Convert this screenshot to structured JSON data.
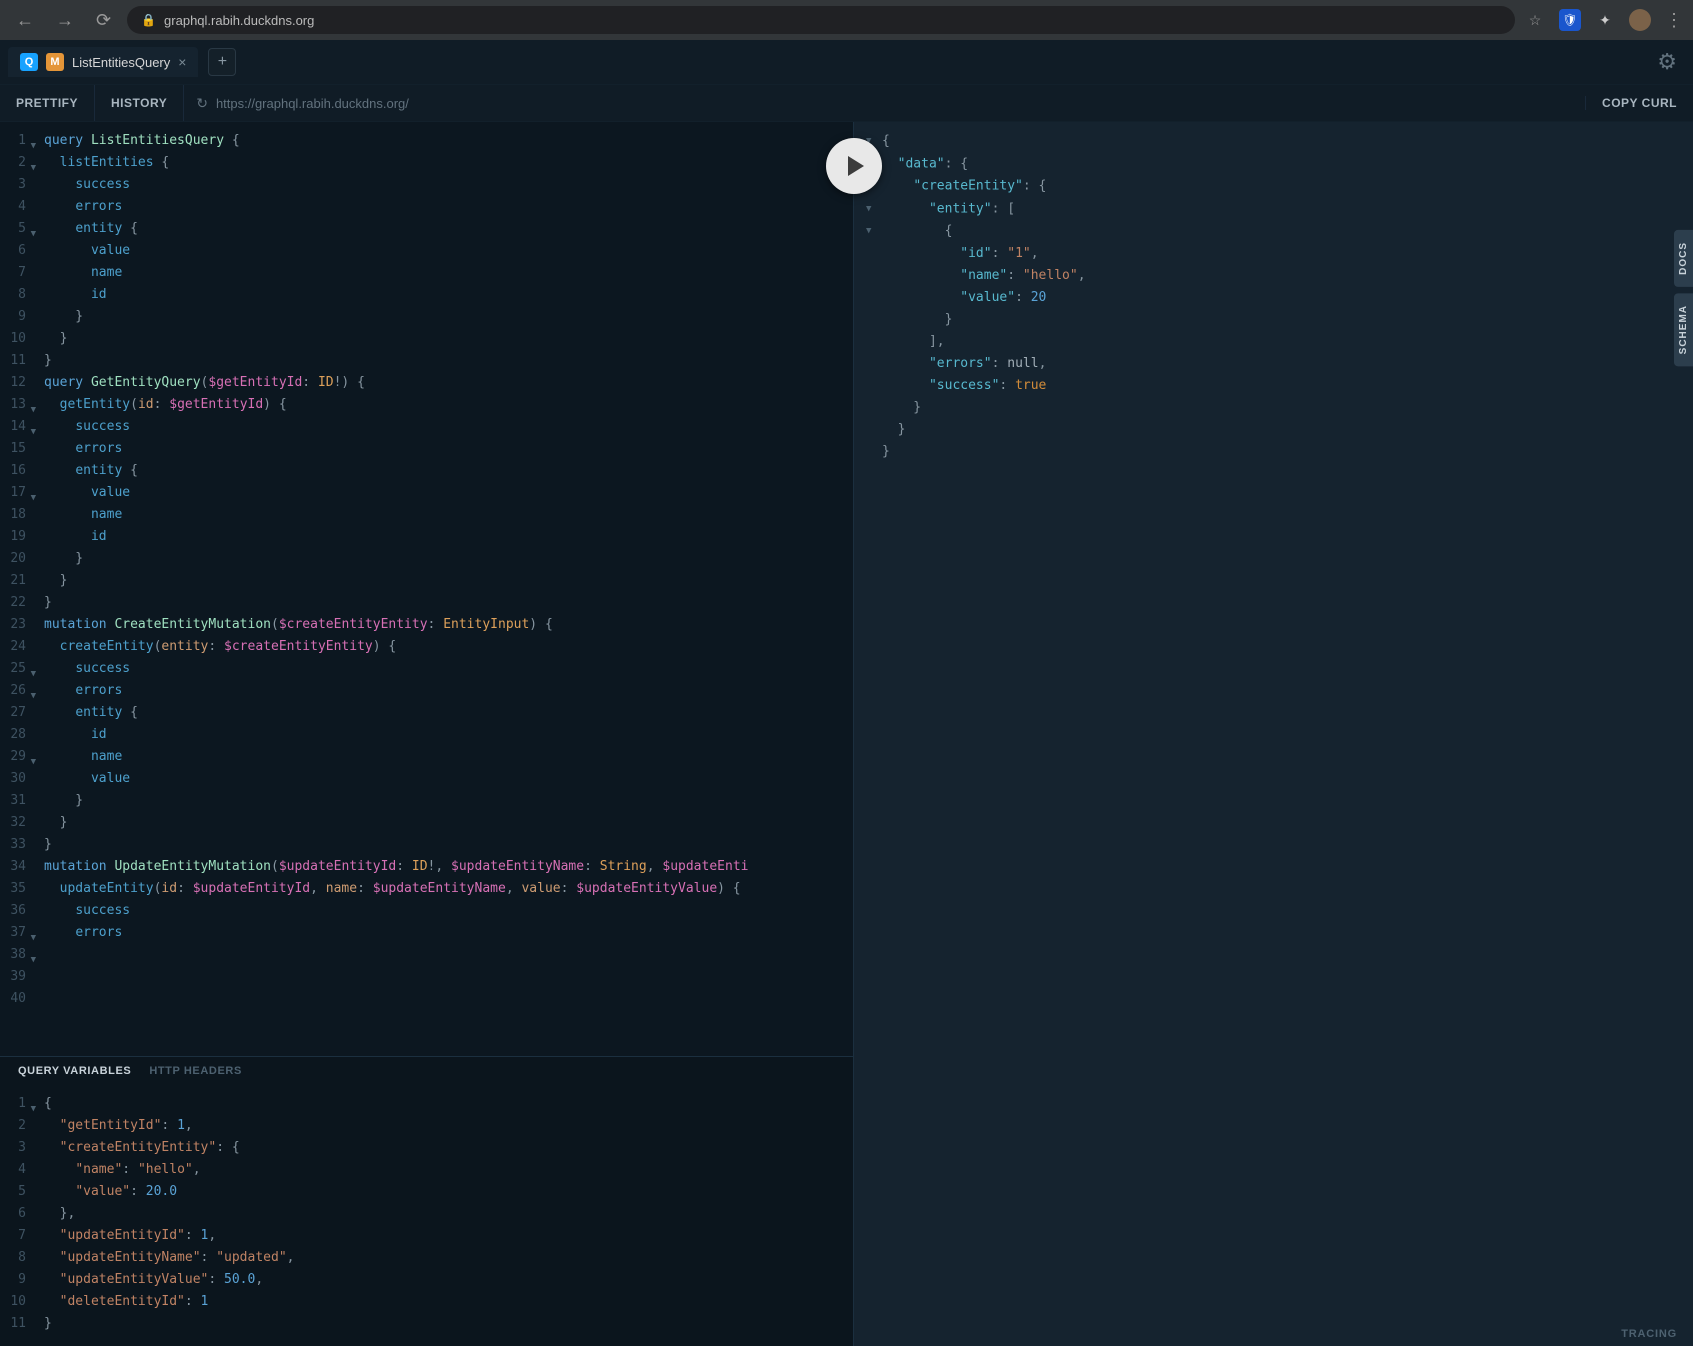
{
  "browser": {
    "url_host": "graphql.rabih.duckdns.org"
  },
  "tab": {
    "title": "ListEntitiesQuery"
  },
  "toolbar": {
    "prettify": "PRETTIFY",
    "history": "HISTORY",
    "url": "https://graphql.rabih.duckdns.org/",
    "copy_curl": "COPY CURL"
  },
  "side_tabs": {
    "docs": "DOCS",
    "schema": "SCHEMA"
  },
  "vars_tabs": {
    "query_vars": "QUERY VARIABLES",
    "http_headers": "HTTP HEADERS"
  },
  "tracing": "TRACING",
  "query_lines": [
    {
      "n": 1,
      "fold": true,
      "t": [
        [
          "k-def",
          "query "
        ],
        [
          "k-name",
          "ListEntitiesQuery"
        ],
        [
          "k-punct",
          " {"
        ]
      ]
    },
    {
      "n": 2,
      "fold": true,
      "t": [
        [
          "k-punct",
          "  "
        ],
        [
          "k-field",
          "listEntities"
        ],
        [
          "k-punct",
          " {"
        ]
      ]
    },
    {
      "n": 3,
      "t": [
        [
          "k-punct",
          "    "
        ],
        [
          "k-field",
          "success"
        ]
      ]
    },
    {
      "n": 4,
      "t": [
        [
          "k-punct",
          "    "
        ],
        [
          "k-field",
          "errors"
        ]
      ]
    },
    {
      "n": 5,
      "fold": true,
      "t": [
        [
          "k-punct",
          "    "
        ],
        [
          "k-field",
          "entity"
        ],
        [
          "k-punct",
          " {"
        ]
      ]
    },
    {
      "n": 6,
      "t": [
        [
          "k-punct",
          "      "
        ],
        [
          "k-field",
          "value"
        ]
      ]
    },
    {
      "n": 7,
      "t": [
        [
          "k-punct",
          "      "
        ],
        [
          "k-field",
          "name"
        ]
      ]
    },
    {
      "n": 8,
      "t": [
        [
          "k-punct",
          "      "
        ],
        [
          "k-field",
          "id"
        ]
      ]
    },
    {
      "n": 9,
      "t": [
        [
          "k-punct",
          "    }"
        ]
      ]
    },
    {
      "n": 10,
      "t": [
        [
          "k-punct",
          "  }"
        ]
      ]
    },
    {
      "n": 11,
      "t": [
        [
          "k-punct",
          "}"
        ]
      ]
    },
    {
      "n": 12,
      "t": [
        [
          "k-punct",
          ""
        ]
      ]
    },
    {
      "n": 13,
      "fold": true,
      "t": [
        [
          "k-def",
          "query "
        ],
        [
          "k-name",
          "GetEntityQuery"
        ],
        [
          "k-punct",
          "("
        ],
        [
          "k-var",
          "$getEntityId"
        ],
        [
          "k-punct",
          ": "
        ],
        [
          "k-type",
          "ID"
        ],
        [
          "k-punct",
          "!) {"
        ]
      ]
    },
    {
      "n": 14,
      "fold": true,
      "t": [
        [
          "k-punct",
          "  "
        ],
        [
          "k-field",
          "getEntity"
        ],
        [
          "k-punct",
          "("
        ],
        [
          "k-fieldr",
          "id"
        ],
        [
          "k-punct",
          ": "
        ],
        [
          "k-var",
          "$getEntityId"
        ],
        [
          "k-punct",
          ") {"
        ]
      ]
    },
    {
      "n": 15,
      "t": [
        [
          "k-punct",
          "    "
        ],
        [
          "k-field",
          "success"
        ]
      ]
    },
    {
      "n": 16,
      "t": [
        [
          "k-punct",
          "    "
        ],
        [
          "k-field",
          "errors"
        ]
      ]
    },
    {
      "n": 17,
      "fold": true,
      "t": [
        [
          "k-punct",
          "    "
        ],
        [
          "k-field",
          "entity"
        ],
        [
          "k-punct",
          " {"
        ]
      ]
    },
    {
      "n": 18,
      "t": [
        [
          "k-punct",
          "      "
        ],
        [
          "k-field",
          "value"
        ]
      ]
    },
    {
      "n": 19,
      "t": [
        [
          "k-punct",
          "      "
        ],
        [
          "k-field",
          "name"
        ]
      ]
    },
    {
      "n": 20,
      "t": [
        [
          "k-punct",
          "      "
        ],
        [
          "k-field",
          "id"
        ]
      ]
    },
    {
      "n": 21,
      "t": [
        [
          "k-punct",
          "    }"
        ]
      ]
    },
    {
      "n": 22,
      "t": [
        [
          "k-punct",
          "  }"
        ]
      ]
    },
    {
      "n": 23,
      "t": [
        [
          "k-punct",
          "}"
        ]
      ]
    },
    {
      "n": 24,
      "t": [
        [
          "k-punct",
          ""
        ]
      ]
    },
    {
      "n": 25,
      "fold": true,
      "t": [
        [
          "k-def",
          "mutation "
        ],
        [
          "k-name",
          "CreateEntityMutation"
        ],
        [
          "k-punct",
          "("
        ],
        [
          "k-var",
          "$createEntityEntity"
        ],
        [
          "k-punct",
          ": "
        ],
        [
          "k-type",
          "EntityInput"
        ],
        [
          "k-punct",
          ") {"
        ]
      ]
    },
    {
      "n": 26,
      "fold": true,
      "t": [
        [
          "k-punct",
          "  "
        ],
        [
          "k-field",
          "createEntity"
        ],
        [
          "k-punct",
          "("
        ],
        [
          "k-fieldr",
          "entity"
        ],
        [
          "k-punct",
          ": "
        ],
        [
          "k-var",
          "$createEntityEntity"
        ],
        [
          "k-punct",
          ") {"
        ]
      ]
    },
    {
      "n": 27,
      "t": [
        [
          "k-punct",
          "    "
        ],
        [
          "k-field",
          "success"
        ]
      ]
    },
    {
      "n": 28,
      "t": [
        [
          "k-punct",
          "    "
        ],
        [
          "k-field",
          "errors"
        ]
      ]
    },
    {
      "n": 29,
      "fold": true,
      "t": [
        [
          "k-punct",
          "    "
        ],
        [
          "k-field",
          "entity"
        ],
        [
          "k-punct",
          " {"
        ]
      ]
    },
    {
      "n": 30,
      "t": [
        [
          "k-punct",
          "      "
        ],
        [
          "k-field",
          "id"
        ]
      ]
    },
    {
      "n": 31,
      "t": [
        [
          "k-punct",
          "      "
        ],
        [
          "k-field",
          "name"
        ]
      ]
    },
    {
      "n": 32,
      "t": [
        [
          "k-punct",
          "      "
        ],
        [
          "k-field",
          "value"
        ]
      ]
    },
    {
      "n": 33,
      "t": [
        [
          "k-punct",
          "    }"
        ]
      ]
    },
    {
      "n": 34,
      "t": [
        [
          "k-punct",
          "  }"
        ]
      ]
    },
    {
      "n": 35,
      "t": [
        [
          "k-punct",
          "}"
        ]
      ]
    },
    {
      "n": 36,
      "t": [
        [
          "k-punct",
          ""
        ]
      ]
    },
    {
      "n": 37,
      "fold": true,
      "t": [
        [
          "k-def",
          "mutation "
        ],
        [
          "k-name",
          "UpdateEntityMutation"
        ],
        [
          "k-punct",
          "("
        ],
        [
          "k-var",
          "$updateEntityId"
        ],
        [
          "k-punct",
          ": "
        ],
        [
          "k-type",
          "ID"
        ],
        [
          "k-punct",
          "!, "
        ],
        [
          "k-var",
          "$updateEntityName"
        ],
        [
          "k-punct",
          ": "
        ],
        [
          "k-type",
          "String"
        ],
        [
          "k-punct",
          ", "
        ],
        [
          "k-var",
          "$updateEnti"
        ]
      ]
    },
    {
      "n": 38,
      "fold": true,
      "t": [
        [
          "k-punct",
          "  "
        ],
        [
          "k-field",
          "updateEntity"
        ],
        [
          "k-punct",
          "("
        ],
        [
          "k-fieldr",
          "id"
        ],
        [
          "k-punct",
          ": "
        ],
        [
          "k-var",
          "$updateEntityId"
        ],
        [
          "k-punct",
          ", "
        ],
        [
          "k-fieldr",
          "name"
        ],
        [
          "k-punct",
          ": "
        ],
        [
          "k-var",
          "$updateEntityName"
        ],
        [
          "k-punct",
          ", "
        ],
        [
          "k-fieldr",
          "value"
        ],
        [
          "k-punct",
          ": "
        ],
        [
          "k-var",
          "$updateEntityValue"
        ],
        [
          "k-punct",
          ") {"
        ]
      ]
    },
    {
      "n": 39,
      "t": [
        [
          "k-punct",
          "    "
        ],
        [
          "k-field",
          "success"
        ]
      ]
    },
    {
      "n": 40,
      "t": [
        [
          "k-punct",
          "    "
        ],
        [
          "k-field",
          "errors"
        ]
      ]
    }
  ],
  "var_lines": [
    {
      "n": 1,
      "fold": true,
      "t": [
        [
          "k-punct",
          "{"
        ]
      ]
    },
    {
      "n": 2,
      "t": [
        [
          "k-punct",
          "  "
        ],
        [
          "vk-prop",
          "\"getEntityId\""
        ],
        [
          "k-punct",
          ": "
        ],
        [
          "k-num",
          "1"
        ],
        [
          "k-punct",
          ","
        ]
      ]
    },
    {
      "n": 3,
      "t": [
        [
          "k-punct",
          "  "
        ],
        [
          "vk-prop",
          "\"createEntityEntity\""
        ],
        [
          "k-punct",
          ": {"
        ]
      ]
    },
    {
      "n": 4,
      "t": [
        [
          "k-punct",
          "    "
        ],
        [
          "vk-prop",
          "\"name\""
        ],
        [
          "k-punct",
          ": "
        ],
        [
          "k-str",
          "\"hello\""
        ],
        [
          "k-punct",
          ","
        ]
      ]
    },
    {
      "n": 5,
      "t": [
        [
          "k-punct",
          "    "
        ],
        [
          "vk-prop",
          "\"value\""
        ],
        [
          "k-punct",
          ": "
        ],
        [
          "k-num",
          "20.0"
        ]
      ]
    },
    {
      "n": 6,
      "t": [
        [
          "k-punct",
          "  },"
        ]
      ]
    },
    {
      "n": 7,
      "t": [
        [
          "k-punct",
          "  "
        ],
        [
          "vk-prop",
          "\"updateEntityId\""
        ],
        [
          "k-punct",
          ": "
        ],
        [
          "k-num",
          "1"
        ],
        [
          "k-punct",
          ","
        ]
      ]
    },
    {
      "n": 8,
      "t": [
        [
          "k-punct",
          "  "
        ],
        [
          "vk-prop",
          "\"updateEntityName\""
        ],
        [
          "k-punct",
          ": "
        ],
        [
          "k-str",
          "\"updated\""
        ],
        [
          "k-punct",
          ","
        ]
      ]
    },
    {
      "n": 9,
      "t": [
        [
          "k-punct",
          "  "
        ],
        [
          "vk-prop",
          "\"updateEntityValue\""
        ],
        [
          "k-punct",
          ": "
        ],
        [
          "k-num",
          "50.0"
        ],
        [
          "k-punct",
          ","
        ]
      ]
    },
    {
      "n": 10,
      "t": [
        [
          "k-punct",
          "  "
        ],
        [
          "vk-prop",
          "\"deleteEntityId\""
        ],
        [
          "k-punct",
          ": "
        ],
        [
          "k-num",
          "1"
        ]
      ]
    },
    {
      "n": 11,
      "t": [
        [
          "k-punct",
          "}"
        ]
      ]
    }
  ],
  "response_lines": [
    {
      "fold": true,
      "t": [
        [
          "k-punct",
          "{"
        ]
      ]
    },
    {
      "fold": true,
      "t": [
        [
          "k-punct",
          "  "
        ],
        [
          "k-prop",
          "\"data\""
        ],
        [
          "k-punct",
          ": {"
        ]
      ]
    },
    {
      "fold": true,
      "t": [
        [
          "k-punct",
          "    "
        ],
        [
          "k-prop",
          "\"createEntity\""
        ],
        [
          "k-punct",
          ": {"
        ]
      ]
    },
    {
      "fold": true,
      "t": [
        [
          "k-punct",
          "      "
        ],
        [
          "k-prop",
          "\"entity\""
        ],
        [
          "k-punct",
          ": ["
        ]
      ]
    },
    {
      "fold": true,
      "t": [
        [
          "k-punct",
          "        {"
        ]
      ]
    },
    {
      "t": [
        [
          "k-punct",
          "          "
        ],
        [
          "k-prop",
          "\"id\""
        ],
        [
          "k-punct",
          ": "
        ],
        [
          "k-str",
          "\"1\""
        ],
        [
          "k-punct",
          ","
        ]
      ]
    },
    {
      "t": [
        [
          "k-punct",
          "          "
        ],
        [
          "k-prop",
          "\"name\""
        ],
        [
          "k-punct",
          ": "
        ],
        [
          "k-str",
          "\"hello\""
        ],
        [
          "k-punct",
          ","
        ]
      ]
    },
    {
      "t": [
        [
          "k-punct",
          "          "
        ],
        [
          "k-prop",
          "\"value\""
        ],
        [
          "k-punct",
          ": "
        ],
        [
          "k-num",
          "20"
        ]
      ]
    },
    {
      "t": [
        [
          "k-punct",
          "        }"
        ]
      ]
    },
    {
      "t": [
        [
          "k-punct",
          "      ],"
        ]
      ]
    },
    {
      "t": [
        [
          "k-punct",
          "      "
        ],
        [
          "k-prop",
          "\"errors\""
        ],
        [
          "k-punct",
          ": "
        ],
        [
          "k-null",
          "null"
        ],
        [
          "k-punct",
          ","
        ]
      ]
    },
    {
      "t": [
        [
          "k-punct",
          "      "
        ],
        [
          "k-prop",
          "\"success\""
        ],
        [
          "k-punct",
          ": "
        ],
        [
          "k-bool",
          "true"
        ]
      ]
    },
    {
      "t": [
        [
          "k-punct",
          "    }"
        ]
      ]
    },
    {
      "t": [
        [
          "k-punct",
          "  }"
        ]
      ]
    },
    {
      "t": [
        [
          "k-punct",
          "}"
        ]
      ]
    }
  ]
}
